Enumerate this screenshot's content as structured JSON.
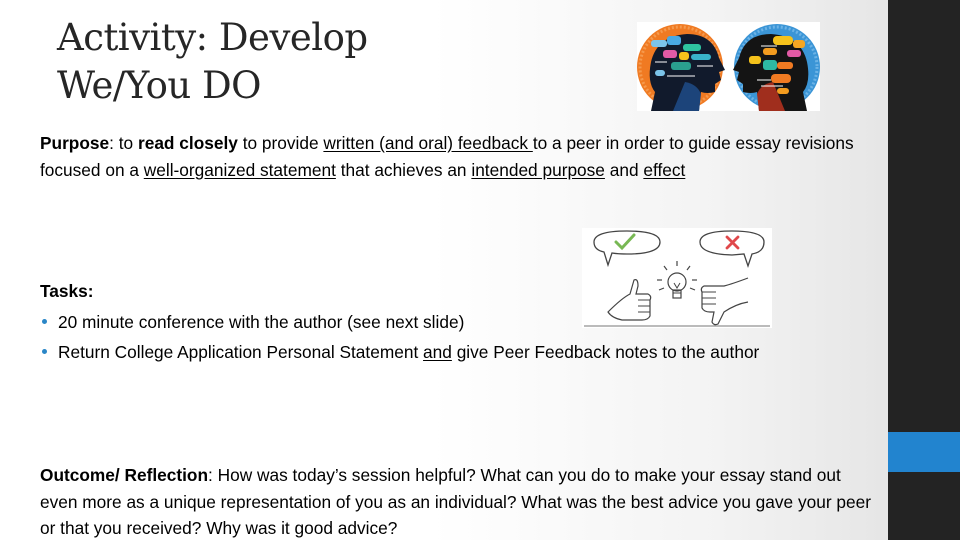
{
  "slide": {
    "title_lines": [
      "Activity: Develop",
      "We/You DO"
    ],
    "purpose": {
      "label": "Purpose",
      "t1": ": to ",
      "read_closely": "read closely",
      "t2": " to provide ",
      "written_feedback": "written (and oral) feedback ",
      "t3": "to a peer in order to guide essay revisions focused on a ",
      "well_organized": "well-organized statement",
      "t4": " that achieves an ",
      "intended_purpose": "intended purpose",
      "t5": " and ",
      "effect": "effect"
    },
    "tasks": {
      "heading": "Tasks:",
      "items": [
        {
          "text": "20 minute conference with the author (see next slide)"
        },
        {
          "pre": "Return College Application Personal Statement ",
          "underlined": "and",
          "post": " give Peer Feedback notes to the author"
        }
      ]
    },
    "outcome": {
      "label": "Outcome/ Reflection",
      "text": ": How was today’s session helpful? What can you do to make your essay stand out even more as a unique representation of you as an individual? What was the best advice you gave your peer or that you received? Why was it good advice?"
    },
    "images": {
      "heads": "two-heads-thinking-speech-bubbles-image",
      "thumbs": "thumbs-up-down-feedback-lightbulb-image"
    },
    "colors": {
      "sidebar": "#232323",
      "accent": "#2284cf",
      "bullet": "#2a86c7",
      "title": "#262626"
    }
  }
}
